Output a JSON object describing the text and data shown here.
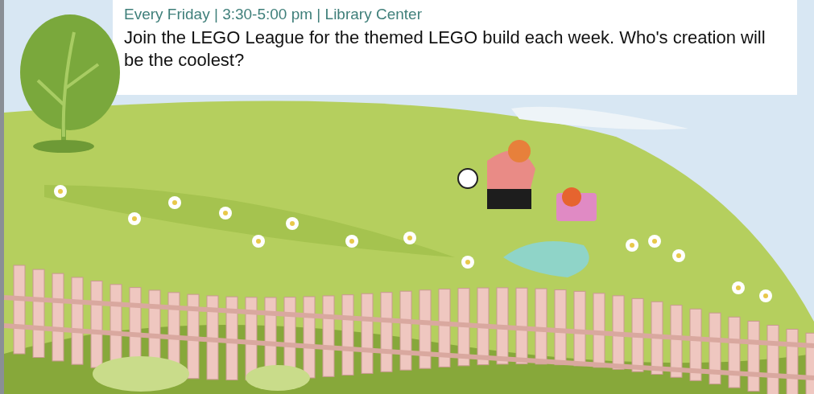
{
  "event": {
    "schedule": "Every Friday | 3:30-5:00 pm | Library Center",
    "description": "Join the LEGO League for the themed LEGO build each week. Who's creation will be the coolest?"
  }
}
